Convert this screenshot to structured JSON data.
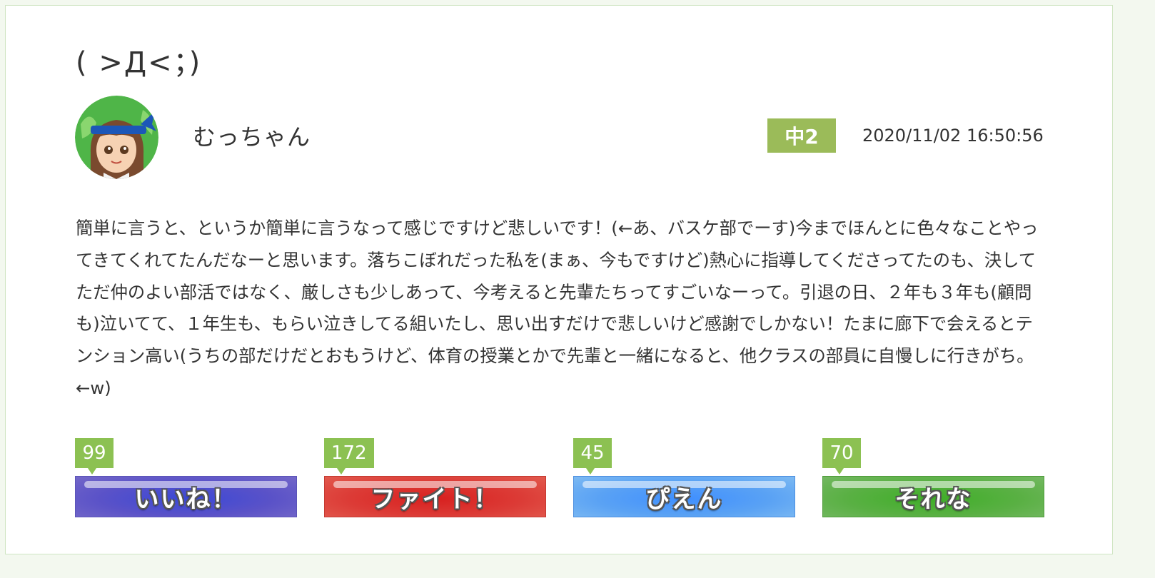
{
  "post": {
    "title": "( >Д<；)",
    "username": "むっちゃん",
    "grade": "中2",
    "timestamp": "2020/11/02 16:50:56",
    "body": "簡単に言うと、というか簡単に言うなって感じですけど悲しいです！(←あ、バスケ部でーす)今までほんとに色々なことやってきてくれてたんだなーと思います。落ちこぼれだった私を(まぁ、今もですけど)熱心に指導してくださってたのも、決してただ仲のよい部活ではなく、厳しさも少しあって、今考えると先輩たちってすごいなーって。引退の日、２年も３年も(顧問も)泣いてて、１年生も、もらい泣きしてる組いたし、思い出すだけで悲しいけど感謝でしかない！たまに廊下で会えるとテンション高い(うちの部だけだとおもうけど、体育の授業とかで先輩と一緒になると、他クラスの部員に自慢しに行きがち。←w)"
  },
  "reactions": [
    {
      "count": "99",
      "label": "いいね！",
      "color": "#5a52c8"
    },
    {
      "count": "172",
      "label": "ファイト！",
      "color": "#dc3b36"
    },
    {
      "count": "45",
      "label": "ぴえん",
      "color": "#5aa2f4"
    },
    {
      "count": "70",
      "label": "それな",
      "color": "#59b043"
    }
  ],
  "colors": {
    "accent": "#9bbb59",
    "badge": "#8cc152",
    "border": "#cfe5c2"
  },
  "icons": {
    "avatar": "avatar-girl-headband-icon"
  }
}
